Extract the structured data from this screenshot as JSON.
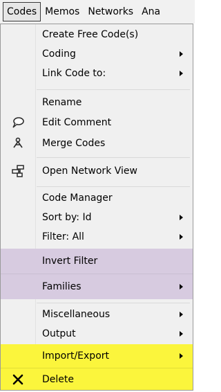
{
  "menubar": {
    "items": [
      "Codes",
      "Memos",
      "Networks",
      "Ana"
    ]
  },
  "menu": {
    "items": [
      {
        "label": "Create Free Code(s)"
      },
      {
        "label": "Coding"
      },
      {
        "label": "Link Code to:"
      },
      {
        "label": "Rename"
      },
      {
        "label": "Edit Comment",
        "icon": "comment-bubble-icon"
      },
      {
        "label": "Merge Codes",
        "icon": "merge-icon"
      },
      {
        "label": "Open Network View",
        "icon": "network-view-icon"
      },
      {
        "label": "Code Manager"
      },
      {
        "label": "Sort by: Id"
      },
      {
        "label": "Filter: All"
      },
      {
        "label": "Invert Filter"
      },
      {
        "label": "Families"
      },
      {
        "label": "Miscellaneous"
      },
      {
        "label": "Output"
      },
      {
        "label": "Import/Export"
      },
      {
        "label": "Delete",
        "icon": "delete-x-icon"
      }
    ]
  },
  "colors": {
    "highlight_purple": "#d7cbe0",
    "highlight_yellow": "#fbf53c"
  }
}
